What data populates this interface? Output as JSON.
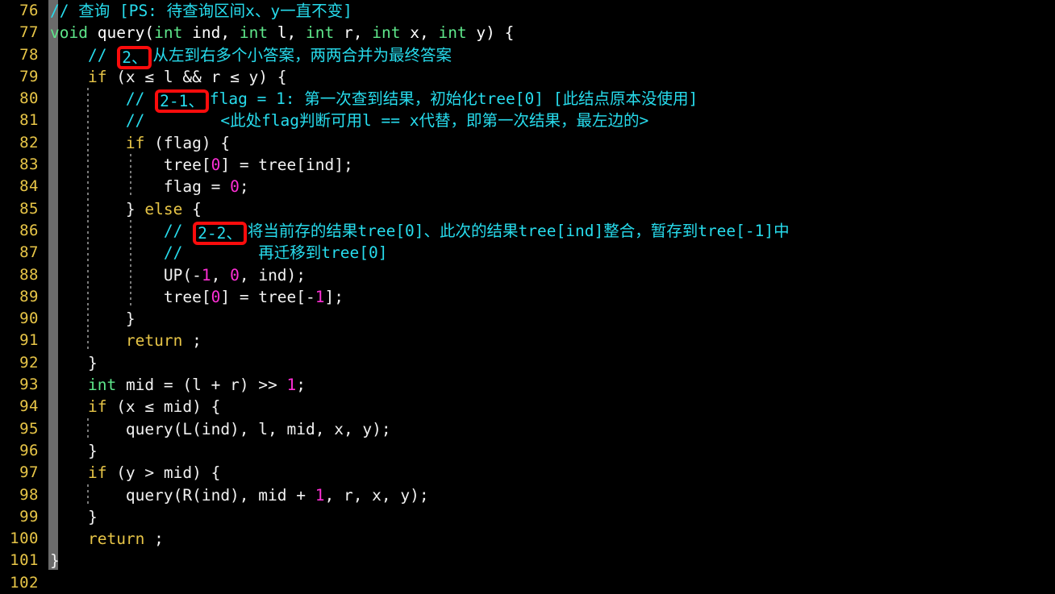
{
  "editor": {
    "theme_background": "#000000",
    "line_number_color": "#e7c547",
    "comment_color": "#27dced",
    "keyword_color": "#e7c547",
    "type_color": "#5ee68a",
    "number_color": "#ff2fd6",
    "text_color": "#f2f2f2",
    "annotation_box_color": "#fb0c0c",
    "fold_column_color": "#6b6b6b"
  },
  "line_numbers": [
    "76",
    "77",
    "78",
    "79",
    "80",
    "81",
    "82",
    "83",
    "84",
    "85",
    "86",
    "87",
    "88",
    "89",
    "90",
    "91",
    "92",
    "93",
    "94",
    "95",
    "96",
    "97",
    "98",
    "99",
    "100",
    "101",
    "102"
  ],
  "code": {
    "l76": {
      "comment_slashes": "//",
      "comment_text": " 查询 [PS: 待查询区间x、y一直不变]"
    },
    "l77": {
      "t1": "void",
      "t2": " query(",
      "t3": "int",
      "t4": " ind, ",
      "t5": "int",
      "t6": " l, ",
      "t7": "int",
      "t8": " r, ",
      "t9": "int",
      "t10": " x, ",
      "t11": "int",
      "t12": " y) {"
    },
    "l78": {
      "indent": "    ",
      "slashes": "// ",
      "badge": "2、",
      "text": "从左到右多个小答案，两两合并为最终答案"
    },
    "l79": {
      "indent": "    ",
      "kw": "if",
      "rest": " (x ≤ l && r ≤ y) {"
    },
    "l80": {
      "indent": "        ",
      "slashes": "// ",
      "badge": "2-1、",
      "text": "flag = 1: 第一次查到结果，初始化tree[0] [此结点原本没使用]"
    },
    "l81": {
      "indent": "        ",
      "slashes": "//",
      "text": "        <此处flag判断可用l == x代替，即第一次结果，最左边的>"
    },
    "l82": {
      "indent": "        ",
      "kw": "if",
      "rest": " (flag) {"
    },
    "l83": {
      "indent": "            ",
      "pre": "tree[",
      "num": "0",
      "post": "] = tree[ind];"
    },
    "l84": {
      "indent": "            ",
      "pre": "flag = ",
      "num": "0",
      "post": ";"
    },
    "l85": {
      "indent": "        ",
      "brace": "} ",
      "kw": "else",
      "rest": " {"
    },
    "l86": {
      "indent": "            ",
      "slashes": "// ",
      "badge": "2-2、",
      "text": "将当前存的结果tree[0]、此次的结果tree[ind]整合，暂存到tree[-1]中"
    },
    "l87": {
      "indent": "            ",
      "slashes": "//",
      "text": "        再迁移到tree[0]"
    },
    "l88": {
      "indent": "            ",
      "pre": "UP(-",
      "num1": "1",
      "mid": ", ",
      "num2": "0",
      "post": ", ind);"
    },
    "l89": {
      "indent": "            ",
      "pre": "tree[",
      "num1": "0",
      "mid": "] = tree[-",
      "num2": "1",
      "post": "];"
    },
    "l90": {
      "indent": "        ",
      "text": "}"
    },
    "l91": {
      "indent": "        ",
      "kw": "return",
      "rest": " ;"
    },
    "l92": {
      "indent": "    ",
      "text": "}"
    },
    "l93": {
      "indent": "    ",
      "type": "int",
      "pre": " mid = (l + r) >> ",
      "num": "1",
      "post": ";"
    },
    "l94": {
      "indent": "    ",
      "kw": "if",
      "rest": " (x ≤ mid) {"
    },
    "l95": {
      "indent": "        ",
      "text": "query(L(ind), l, mid, x, y);"
    },
    "l96": {
      "indent": "    ",
      "text": "}"
    },
    "l97": {
      "indent": "    ",
      "kw": "if",
      "rest": " (y > mid) {"
    },
    "l98": {
      "indent": "        ",
      "pre": "query(R(ind), mid + ",
      "num": "1",
      "post": ", r, x, y);"
    },
    "l99": {
      "indent": "    ",
      "text": "}"
    },
    "l100": {
      "indent": "    ",
      "kw": "return",
      "rest": " ;"
    },
    "l101": {
      "text": "}"
    },
    "l102": {
      "text": ""
    }
  }
}
